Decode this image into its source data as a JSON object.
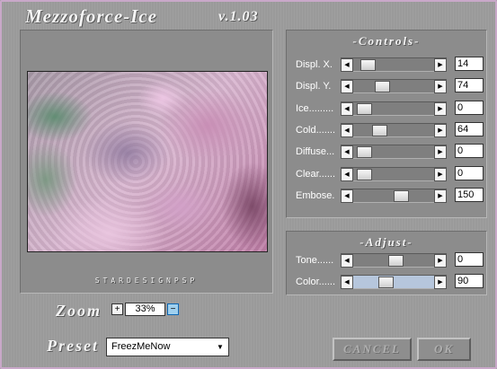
{
  "window": {
    "title": "Mezzoforce-Ice",
    "version": "v.1.03"
  },
  "preview": {
    "signature": "STARDESIGNPSP"
  },
  "controls": {
    "header": "-Controls-",
    "sliders": [
      {
        "label": "Displ. X.",
        "value": "14",
        "level": 0.06
      },
      {
        "label": "Displ. Y.",
        "value": "74",
        "level": 0.29
      },
      {
        "label": "Ice.........",
        "value": "0",
        "level": 0.0
      },
      {
        "label": "Cold.......",
        "value": "64",
        "level": 0.25
      },
      {
        "label": "Diffuse...",
        "value": "0",
        "level": 0.0
      },
      {
        "label": "Clear......",
        "value": "0",
        "level": 0.0
      },
      {
        "label": "Embose.",
        "value": "150",
        "level": 0.59
      }
    ]
  },
  "adjust": {
    "header": "-Adjust-",
    "sliders": [
      {
        "label": "Tone......",
        "value": "0",
        "level": 0.5
      },
      {
        "label": "Color......",
        "value": "90",
        "level": 0.35
      }
    ]
  },
  "zoom": {
    "label": "Zoom",
    "value": "33%",
    "plus": "+",
    "minus": "−"
  },
  "preset": {
    "label": "Preset",
    "value": "FreezMeNow"
  },
  "buttons": {
    "cancel": "CANCEL",
    "ok": "OK"
  },
  "colors": {
    "frame_border": "#c9a8c9",
    "panel_bg": "#8c8c8c",
    "highlight_track": "#b6c6dc"
  },
  "icons": {
    "slider_left": "triangle-left-icon",
    "slider_right": "triangle-right-icon",
    "dropdown": "triangle-down-icon"
  }
}
